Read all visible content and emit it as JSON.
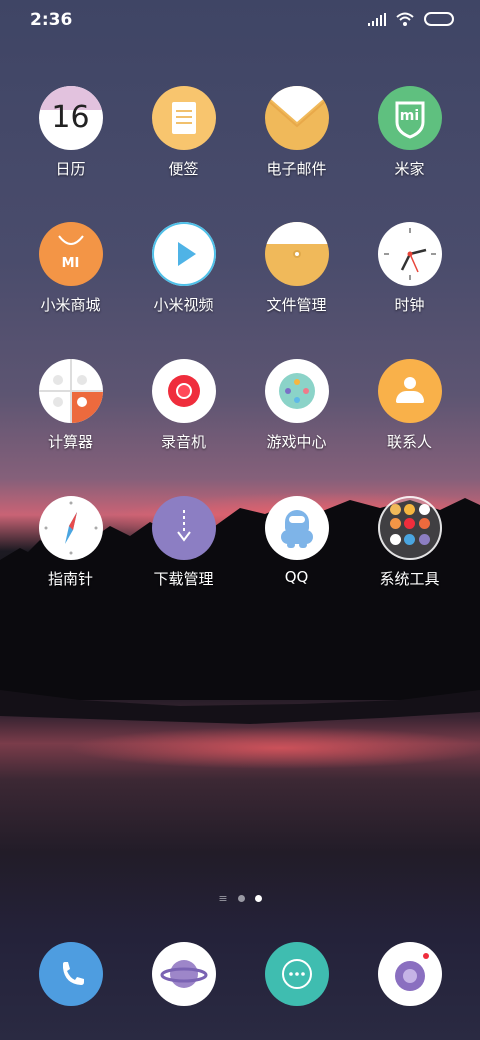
{
  "status_bar": {
    "time": "2:36"
  },
  "apps": [
    {
      "label": "日历",
      "icon": "calendar-icon",
      "date_number": "16"
    },
    {
      "label": "便签",
      "icon": "notes-icon"
    },
    {
      "label": "电子邮件",
      "icon": "mail-icon"
    },
    {
      "label": "米家",
      "icon": "mijia-icon",
      "badge_text": "mi"
    },
    {
      "label": "小米商城",
      "icon": "mi-store-icon",
      "badge_text": "MI"
    },
    {
      "label": "小米视频",
      "icon": "video-icon"
    },
    {
      "label": "文件管理",
      "icon": "file-manager-icon"
    },
    {
      "label": "时钟",
      "icon": "clock-icon"
    },
    {
      "label": "计算器",
      "icon": "calculator-icon"
    },
    {
      "label": "录音机",
      "icon": "recorder-icon"
    },
    {
      "label": "游戏中心",
      "icon": "game-center-icon"
    },
    {
      "label": "联系人",
      "icon": "contacts-icon"
    },
    {
      "label": "指南针",
      "icon": "compass-icon"
    },
    {
      "label": "下载管理",
      "icon": "download-icon"
    },
    {
      "label": "QQ",
      "icon": "qq-icon"
    },
    {
      "label": "系统工具",
      "icon": "folder-system-tools-icon"
    }
  ],
  "page_indicator": {
    "pages": 2,
    "current": 2
  },
  "dock": [
    {
      "icon": "phone-icon"
    },
    {
      "icon": "browser-icon"
    },
    {
      "icon": "messages-icon"
    },
    {
      "icon": "camera-icon"
    }
  ],
  "colors": {
    "calendar_top": "#e2c2de",
    "notes": "#f8c56e",
    "mail": "#f0b95a",
    "mijia": "#5fc07f",
    "mi_store": "#f39546",
    "recorder_red": "#ef2d3c",
    "contacts": "#f9b14a",
    "download": "#8c7ec3",
    "qq": "#7eb4e8",
    "phone": "#4e9de0",
    "messages": "#3fbdb0",
    "camera": "#8a6fc0"
  }
}
